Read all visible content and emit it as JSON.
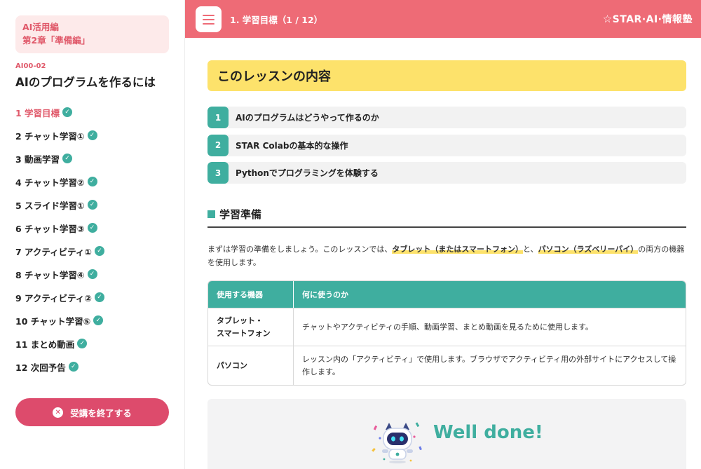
{
  "sidebar": {
    "course_line1": "AI活用編",
    "course_line2": "第2章「準備編」",
    "lesson_code": "AI00-02",
    "lesson_title": "AIのプログラムを作るには",
    "steps": [
      {
        "label": "1 学習目標"
      },
      {
        "label": "2 チャット学習①"
      },
      {
        "label": "3 動画学習"
      },
      {
        "label": "4 チャット学習②"
      },
      {
        "label": "5 スライド学習①"
      },
      {
        "label": "6 チャット学習③"
      },
      {
        "label": "7 アクティビティ①"
      },
      {
        "label": "8 チャット学習④"
      },
      {
        "label": "9 アクティビティ②"
      },
      {
        "label": "10 チャット学習⑤"
      },
      {
        "label": "11 まとめ動画"
      },
      {
        "label": "12 次回予告"
      }
    ],
    "end_button": "受講を終了する"
  },
  "header": {
    "title": "1. 学習目標（1 / 12）",
    "brand": "STAR·AI·情報塾",
    "brand_star": "☆"
  },
  "main": {
    "lesson_header": "このレッスンの内容",
    "objectives": [
      {
        "num": "1",
        "text": "AIのプログラムはどうやって作るのか"
      },
      {
        "num": "2",
        "text": "STAR Colabの基本的な操作"
      },
      {
        "num": "3",
        "text": "Pythonでプログラミングを体験する"
      }
    ],
    "section_title": "学習準備",
    "intro": {
      "part1": "まずは学習の準備をしましょう。このレッスンでは、",
      "hl1": "タブレット（またはスマートフォン）",
      "part2": "と、",
      "hl2": "パソコン（ラズベリーパイ）",
      "part3": "の両方の機器を使用します。"
    },
    "table": {
      "headers": [
        "使用する機器",
        "何に使うのか"
      ],
      "rows": [
        {
          "device": "タブレット・\nスマートフォン",
          "use": "チャットやアクティビティの手順、動画学習、まとめ動画を見るために使用します。"
        },
        {
          "device": "パソコン",
          "use": "レッスン内の「アクティビティ」で使用します。ブラウザでアクティビティ用の外部サイトにアクセスして操作します。"
        }
      ]
    },
    "done_text": "Well done!"
  },
  "colors": {
    "accent_pink": "#ee6b76",
    "teal": "#3fae9f",
    "yellow": "#fde26b",
    "end_button": "#dd4b6c"
  },
  "icons": {
    "menu": "hamburger-menu-icon",
    "check": "check-circle-icon",
    "close": "close-circle-icon",
    "mascot": "robot-mascot-icon"
  }
}
